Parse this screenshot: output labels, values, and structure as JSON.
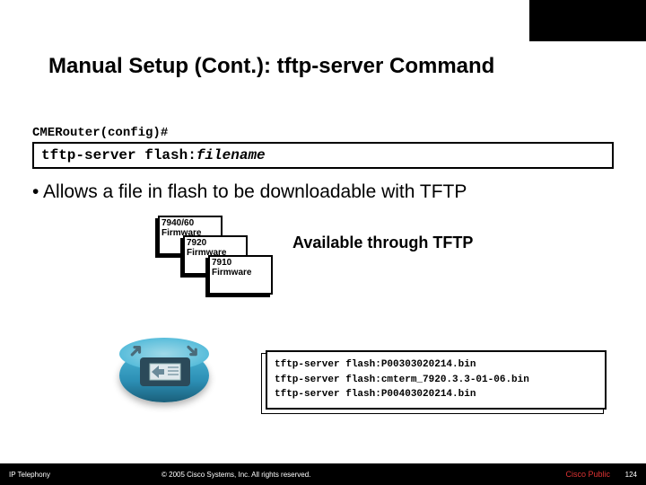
{
  "title": "Manual Setup (Cont.): tftp-server Command",
  "prompt": "CMERouter(config)#",
  "command": {
    "base": "tftp-server flash:",
    "arg": "filename"
  },
  "bullet": "Allows a file in flash to be downloadable with TFTP",
  "docs": [
    {
      "line1": "7940/60",
      "line2": "Firmware"
    },
    {
      "line1": "7920",
      "line2": "Firmware"
    },
    {
      "line1": "7910",
      "line2": "Firmware"
    }
  ],
  "tftp_label": "Available through TFTP",
  "code_lines": [
    "tftp-server flash:P00303020214.bin",
    "tftp-server flash:cmterm_7920.3.3-01-06.bin",
    "tftp-server flash:P00403020214.bin"
  ],
  "footer": {
    "course": "IP Telephony",
    "copyright": "© 2005 Cisco Systems, Inc. All rights reserved.",
    "public": "Cisco Public",
    "page": "124"
  }
}
